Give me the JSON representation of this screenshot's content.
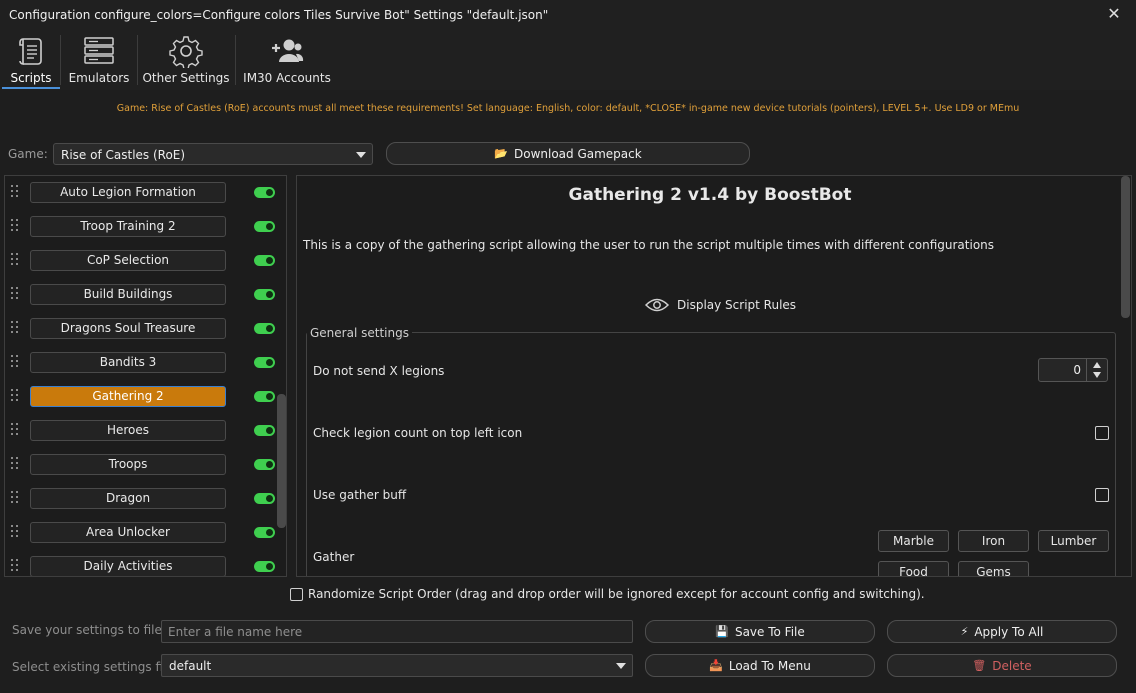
{
  "window": {
    "title": "Configuration configure_colors=Configure colors Tiles Survive Bot\" Settings \"default.json\"",
    "close_symbol": "✕"
  },
  "tabs": [
    {
      "label": "Scripts",
      "icon": "scroll-icon",
      "active": true
    },
    {
      "label": "Emulators",
      "icon": "server-icon",
      "active": false
    },
    {
      "label": "Other Settings",
      "icon": "gear-icon",
      "active": false
    },
    {
      "label": "IM30 Accounts",
      "icon": "users-icon",
      "active": false
    }
  ],
  "notice": "Game: Rise of Castles (RoE) accounts must all meet these requirements! Set language: English, color: default, *CLOSE* in-game new device tutorials (pointers), LEVEL 5+. Use LD9 or MEmu",
  "game": {
    "label": "Game:",
    "selected": "Rise of Castles (RoE)",
    "download_label": "Download Gamepack"
  },
  "scripts": [
    {
      "name": "Auto Legion Formation",
      "enabled": true,
      "selected": false
    },
    {
      "name": "Troop Training 2",
      "enabled": true,
      "selected": false
    },
    {
      "name": "CoP Selection",
      "enabled": true,
      "selected": false
    },
    {
      "name": "Build Buildings",
      "enabled": true,
      "selected": false
    },
    {
      "name": "Dragons Soul Treasure",
      "enabled": true,
      "selected": false
    },
    {
      "name": "Bandits 3",
      "enabled": true,
      "selected": false
    },
    {
      "name": "Gathering 2",
      "enabled": true,
      "selected": true
    },
    {
      "name": "Heroes",
      "enabled": true,
      "selected": false
    },
    {
      "name": "Troops",
      "enabled": true,
      "selected": false
    },
    {
      "name": "Dragon",
      "enabled": true,
      "selected": false
    },
    {
      "name": "Area Unlocker",
      "enabled": true,
      "selected": false
    },
    {
      "name": "Daily Activities",
      "enabled": true,
      "selected": false
    }
  ],
  "detail": {
    "title": "Gathering 2 v1.4 by BoostBot",
    "description": "This is a copy of the gathering script allowing the user to run the script multiple times with different configurations",
    "rules_label": "Display Script Rules",
    "group_title": "General settings",
    "settings": {
      "legions_label": "Do not send X legions",
      "legions_value": "0",
      "legion_count_label": "Check legion count on top left icon",
      "legion_count_checked": false,
      "gather_buff_label": "Use gather buff",
      "gather_buff_checked": false,
      "gather_label": "Gather",
      "resources": [
        "Marble",
        "Iron",
        "Lumber",
        "Food",
        "Gems"
      ]
    }
  },
  "randomize": {
    "label": "Randomize Script Order (drag and drop order will be ignored except for account config and switching).",
    "checked": false
  },
  "footer": {
    "save_label": "Save your settings to file",
    "file_placeholder": "Enter a file name here",
    "save_button": "Save To File",
    "apply_button": "Apply To All",
    "select_label": "Select existing settings file",
    "selected_file": "default",
    "load_button": "Load To Menu",
    "delete_button": "Delete"
  },
  "colors": {
    "accent_selected": "#c97a0c",
    "toggle_on": "#3fcf4f",
    "notice_text": "#e0a03a",
    "delete_text": "#d06060",
    "tab_underline": "#4a90d9"
  }
}
